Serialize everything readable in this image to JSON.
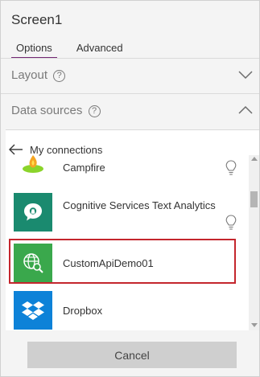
{
  "screen": {
    "title": "Screen1"
  },
  "tabs": [
    {
      "label": "Options",
      "active": true
    },
    {
      "label": "Advanced",
      "active": false
    }
  ],
  "sections": {
    "layout": {
      "label": "Layout",
      "help_icon": "?",
      "state": "collapsed"
    },
    "data_sources": {
      "label": "Data sources",
      "help_icon": "?",
      "state": "expanded"
    }
  },
  "connections": {
    "back_label": "My connections",
    "items": [
      {
        "name": "Campfire",
        "icon": "campfire-logo",
        "color": "#7ed321",
        "lightbulb": true
      },
      {
        "name": "Cognitive Services Text Analytics",
        "icon": "speech-bubble-logo",
        "color": "#1a8a6f",
        "lightbulb": true
      },
      {
        "name": "CustomApiDemo01",
        "icon": "globe-search-logo",
        "color": "#3aa84c",
        "lightbulb": false,
        "highlighted": true
      },
      {
        "name": "Dropbox",
        "icon": "dropbox-logo",
        "color": "#0d82d8",
        "lightbulb": false
      }
    ]
  },
  "footer": {
    "cancel_label": "Cancel"
  },
  "colors": {
    "accent": "#742774",
    "highlight_border": "#c4262d"
  }
}
